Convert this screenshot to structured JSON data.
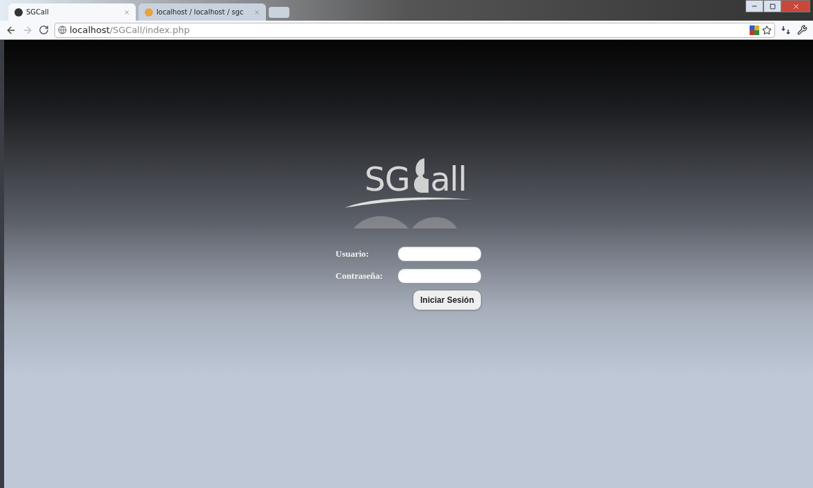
{
  "tabs": [
    {
      "title": "SGCall",
      "selected": true
    },
    {
      "title": "localhost / localhost / sgc",
      "selected": false
    }
  ],
  "address_bar": {
    "host": "localhost",
    "path": "/SGCall/index.php"
  },
  "logo": {
    "text": "SG",
    "text_end": "all"
  },
  "form": {
    "fields": [
      {
        "label": "Usuario:"
      },
      {
        "label": "Contraseña:"
      }
    ],
    "submit": "Iniciar Sesión"
  }
}
